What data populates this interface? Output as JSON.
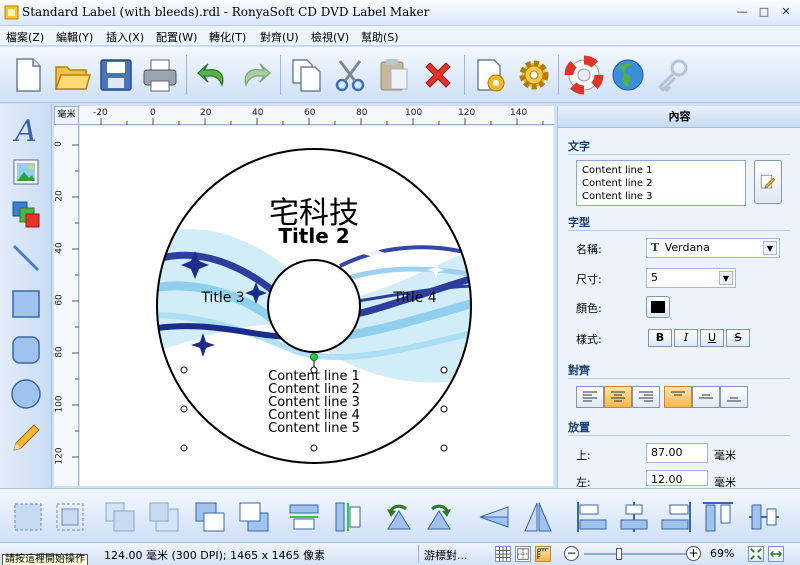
{
  "window": {
    "title": "Standard Label (with bleeds).rdl - RonyaSoft CD DVD Label Maker"
  },
  "menu": [
    "檔案(Z)",
    "編輯(Y)",
    "插入(X)",
    "配置(W)",
    "轉化(T)",
    "對齊(U)",
    "檢視(V)",
    "幫助(S)"
  ],
  "ruler": {
    "unit": "毫米",
    "h_labels": [
      "-20",
      "0",
      "20",
      "40",
      "60",
      "80",
      "100",
      "120",
      "140"
    ],
    "v_labels": [
      "0",
      "20",
      "40",
      "60",
      "80",
      "100",
      "120"
    ]
  },
  "label": {
    "title1": "宅科技",
    "title2": "Title 2",
    "title3": "Title 3",
    "title4": "Title 4",
    "content": [
      "Content line 1",
      "Content line 2",
      "Content line 3",
      "Content line 4",
      "Content line 5"
    ]
  },
  "panel": {
    "header": "內容",
    "text_section": "文字",
    "text_lines": [
      "Content line 1",
      "Content line 2",
      "Content line 3"
    ],
    "font_section": "字型",
    "name_label": "名稱:",
    "font_name": "Verdana",
    "size_label": "尺寸:",
    "font_size": "5",
    "color_label": "顏色:",
    "style_label": "樣式:",
    "style_buttons": [
      "B",
      "I",
      "U",
      "S"
    ],
    "align_section": "對齊",
    "position_section": "放置",
    "top_label": "上:",
    "top_value": "87.00",
    "top_unit": "毫米",
    "left_label": "左:",
    "left_value": "12.00",
    "left_unit": "毫米",
    "color_value": "#000000"
  },
  "status": {
    "left": "請按這裡開始操作",
    "dims": "124.00 毫米 (300 DPI); 1465 x 1465 像素",
    "cursor": "游標對...",
    "zoom": "69%",
    "minus": "−",
    "plus": "+"
  }
}
